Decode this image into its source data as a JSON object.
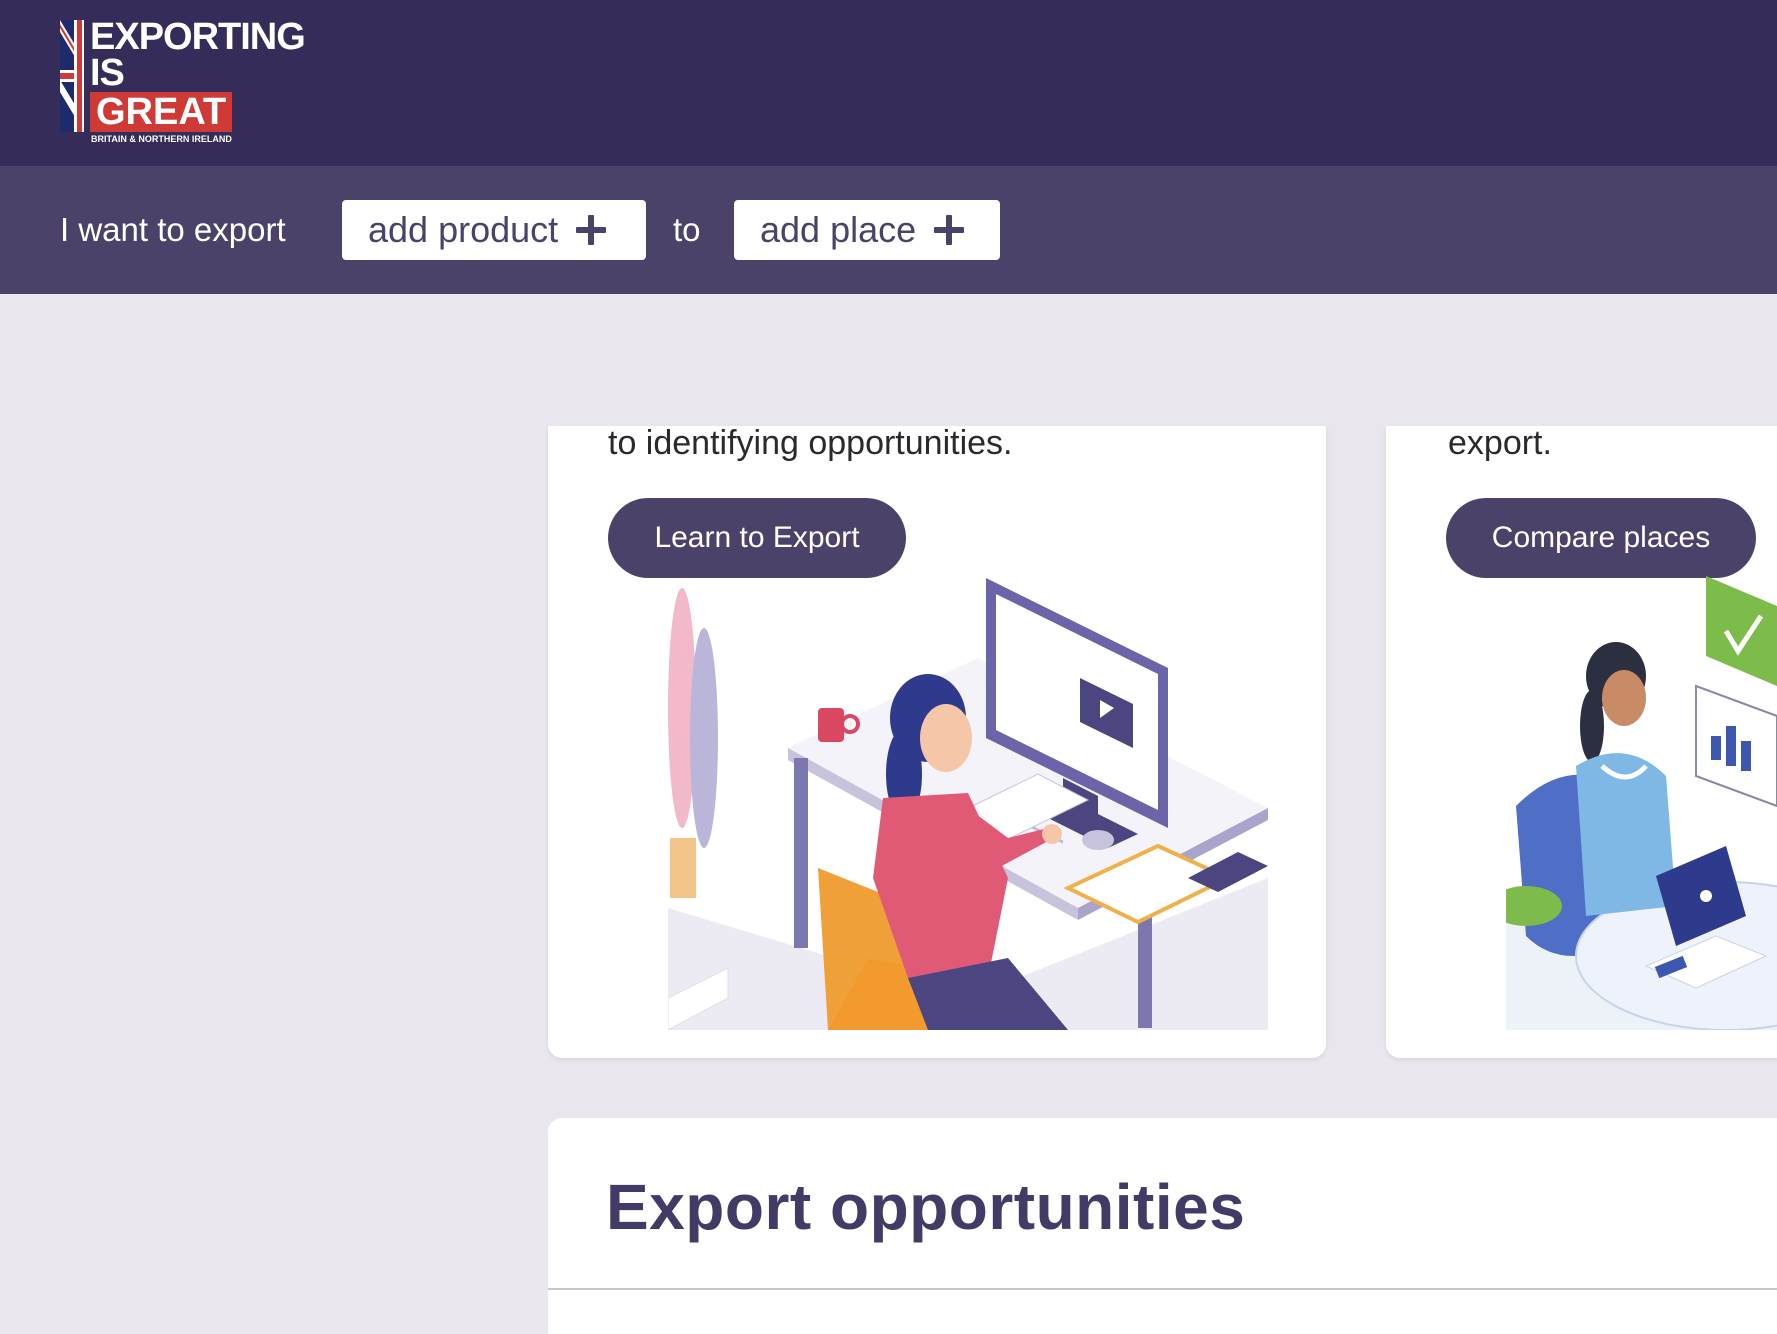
{
  "header": {
    "logo": {
      "line1": "EXPORTING",
      "line2": "IS",
      "line3": "GREAT",
      "subline": "BRITAIN & NORTHERN IRELAND"
    }
  },
  "export_bar": {
    "prefix": "I want to export",
    "product_button": "add product",
    "connector": "to",
    "place_button": "add place"
  },
  "cards": [
    {
      "description_tail": "to identifying opportunities.",
      "button_label": "Learn to Export",
      "illustration": "woman-at-computer-desk-illustration"
    },
    {
      "description_tail": "export.",
      "button_label": "Compare places",
      "illustration": "woman-with-laptop-illustration"
    }
  ],
  "section": {
    "title": "Export opportunities"
  },
  "colors": {
    "header_bg": "#352c59",
    "bar_bg": "#4b4269",
    "page_bg": "#e9e7ed",
    "accent_red": "#cf3a36"
  }
}
